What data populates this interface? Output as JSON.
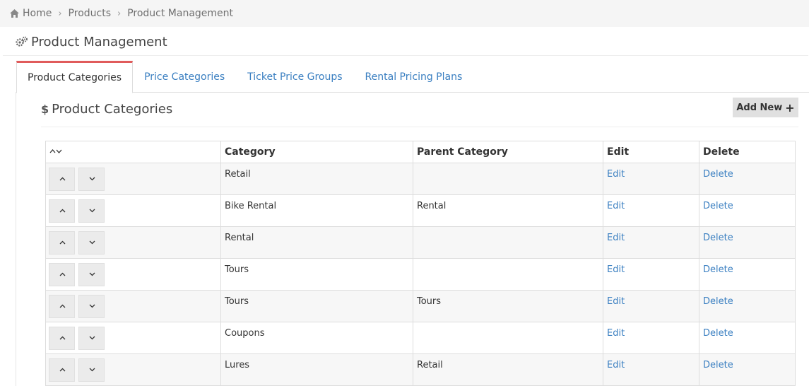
{
  "breadcrumb": {
    "home": "Home",
    "products": "Products",
    "current": "Product Management",
    "icon": "home-icon"
  },
  "page": {
    "title": "Product Management",
    "icon": "gears-icon"
  },
  "tabs": [
    {
      "label": "Product Categories",
      "active": true
    },
    {
      "label": "Price Categories",
      "active": false
    },
    {
      "label": "Ticket Price Groups",
      "active": false
    },
    {
      "label": "Rental Pricing Plans",
      "active": false
    }
  ],
  "section": {
    "icon_text": "$",
    "title": "Product Categories",
    "add_new_label": "Add New",
    "add_new_icon": "+"
  },
  "table": {
    "headers": {
      "sort": "^v",
      "category": "Category",
      "parent": "Parent Category",
      "edit": "Edit",
      "delete": "Delete"
    },
    "rows": [
      {
        "category": "Retail",
        "parent": "",
        "edit": "Edit",
        "delete": "Delete"
      },
      {
        "category": "Bike Rental",
        "parent": "Rental",
        "edit": "Edit",
        "delete": "Delete"
      },
      {
        "category": "Rental",
        "parent": "",
        "edit": "Edit",
        "delete": "Delete"
      },
      {
        "category": "Tours",
        "parent": "",
        "edit": "Edit",
        "delete": "Delete"
      },
      {
        "category": "Tours",
        "parent": "Tours",
        "edit": "Edit",
        "delete": "Delete"
      },
      {
        "category": "Coupons",
        "parent": "",
        "edit": "Edit",
        "delete": "Delete"
      },
      {
        "category": "Lures",
        "parent": "Retail",
        "edit": "Edit",
        "delete": "Delete"
      }
    ]
  },
  "colors": {
    "link": "#3a7fc1",
    "active_tab_accent": "#e05b5b",
    "breadcrumb_bg": "#f5f5f5"
  }
}
